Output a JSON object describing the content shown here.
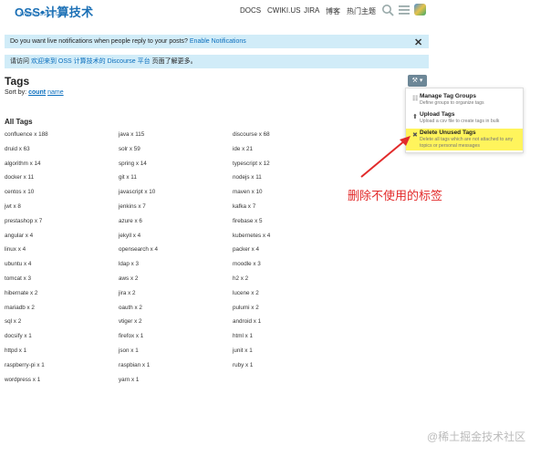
{
  "header": {
    "logo_title": "OSS•计算技术",
    "logo_sub": "WWW.OSSEZ.COM",
    "nav": [
      "DOCS",
      "CWIKI.US",
      "JIRA",
      "博客",
      "热门主题"
    ]
  },
  "banners": {
    "notify_text": "Do you want live notifications when people reply to your posts? ",
    "notify_link": "Enable Notifications",
    "welcome_prefix": "请访问 ",
    "welcome_link": "欢迎来到 OSS 计算技术的 Discourse 平台",
    "welcome_suffix": " 页面了解更多。"
  },
  "page": {
    "title": "Tags",
    "sort_label": "Sort by: ",
    "sort_count": "count",
    "sort_name": "name",
    "all_tags": "All Tags"
  },
  "toolbar": {
    "wrench_label": "⚒ ▾"
  },
  "menu": {
    "items": [
      {
        "icon": "users-icon",
        "glyph": "☷",
        "title": "Manage Tag Groups",
        "desc": "Define groups to organize tags"
      },
      {
        "icon": "upload-icon",
        "glyph": "⬆",
        "title": "Upload Tags",
        "desc": "Upload a csv file to create tags in bulk"
      },
      {
        "icon": "trash-icon",
        "glyph": "✖",
        "title": "Delete Unused Tags",
        "desc": "Delete all tags which are not attached to any topics or personal messages"
      }
    ]
  },
  "annotation": "删除不使用的标签",
  "watermark": "@稀土掘金技术社区",
  "tags": {
    "col1": [
      "confluence x 188",
      "druid x 63",
      "algorithm x 14",
      "docker x 11",
      "centos x 10",
      "jwt x 8",
      "prestashop x 7",
      "angular x 4",
      "linux x 4",
      "ubuntu x 4",
      "tomcat x 3",
      "hibernate x 2",
      "mariadb x 2",
      "sql x 2",
      "docsify x 1",
      "httpd x 1",
      "raspberry-pi x 1",
      "wordpress x 1"
    ],
    "col2": [
      "java x 115",
      "solr x 59",
      "spring x 14",
      "git x 11",
      "javascript x 10",
      "jenkins x 7",
      "azure x 6",
      "jekyll x 4",
      "opensearch x 4",
      "ldap x 3",
      "aws x 2",
      "jira x 2",
      "oauth x 2",
      "vtiger x 2",
      "firefox x 1",
      "json x 1",
      "raspbian x 1",
      "yarn x 1"
    ],
    "col3": [
      "discourse x 68",
      "ide x 21",
      "typescript x 12",
      "nodejs x 11",
      "maven x 10",
      "kafka x 7",
      "firebase x 5",
      "kubernetes x 4",
      "packer x 4",
      "moodle x 3",
      "h2 x 2",
      "lucene x 2",
      "pulumi x 2",
      "android x 1",
      "html x 1",
      "junit x 1",
      "ruby x 1"
    ]
  },
  "colors": {
    "accent": "#0a6ebd",
    "banner": "#d1ecf8",
    "highlight": "#fff45c",
    "annotation": "#e22b2b"
  }
}
